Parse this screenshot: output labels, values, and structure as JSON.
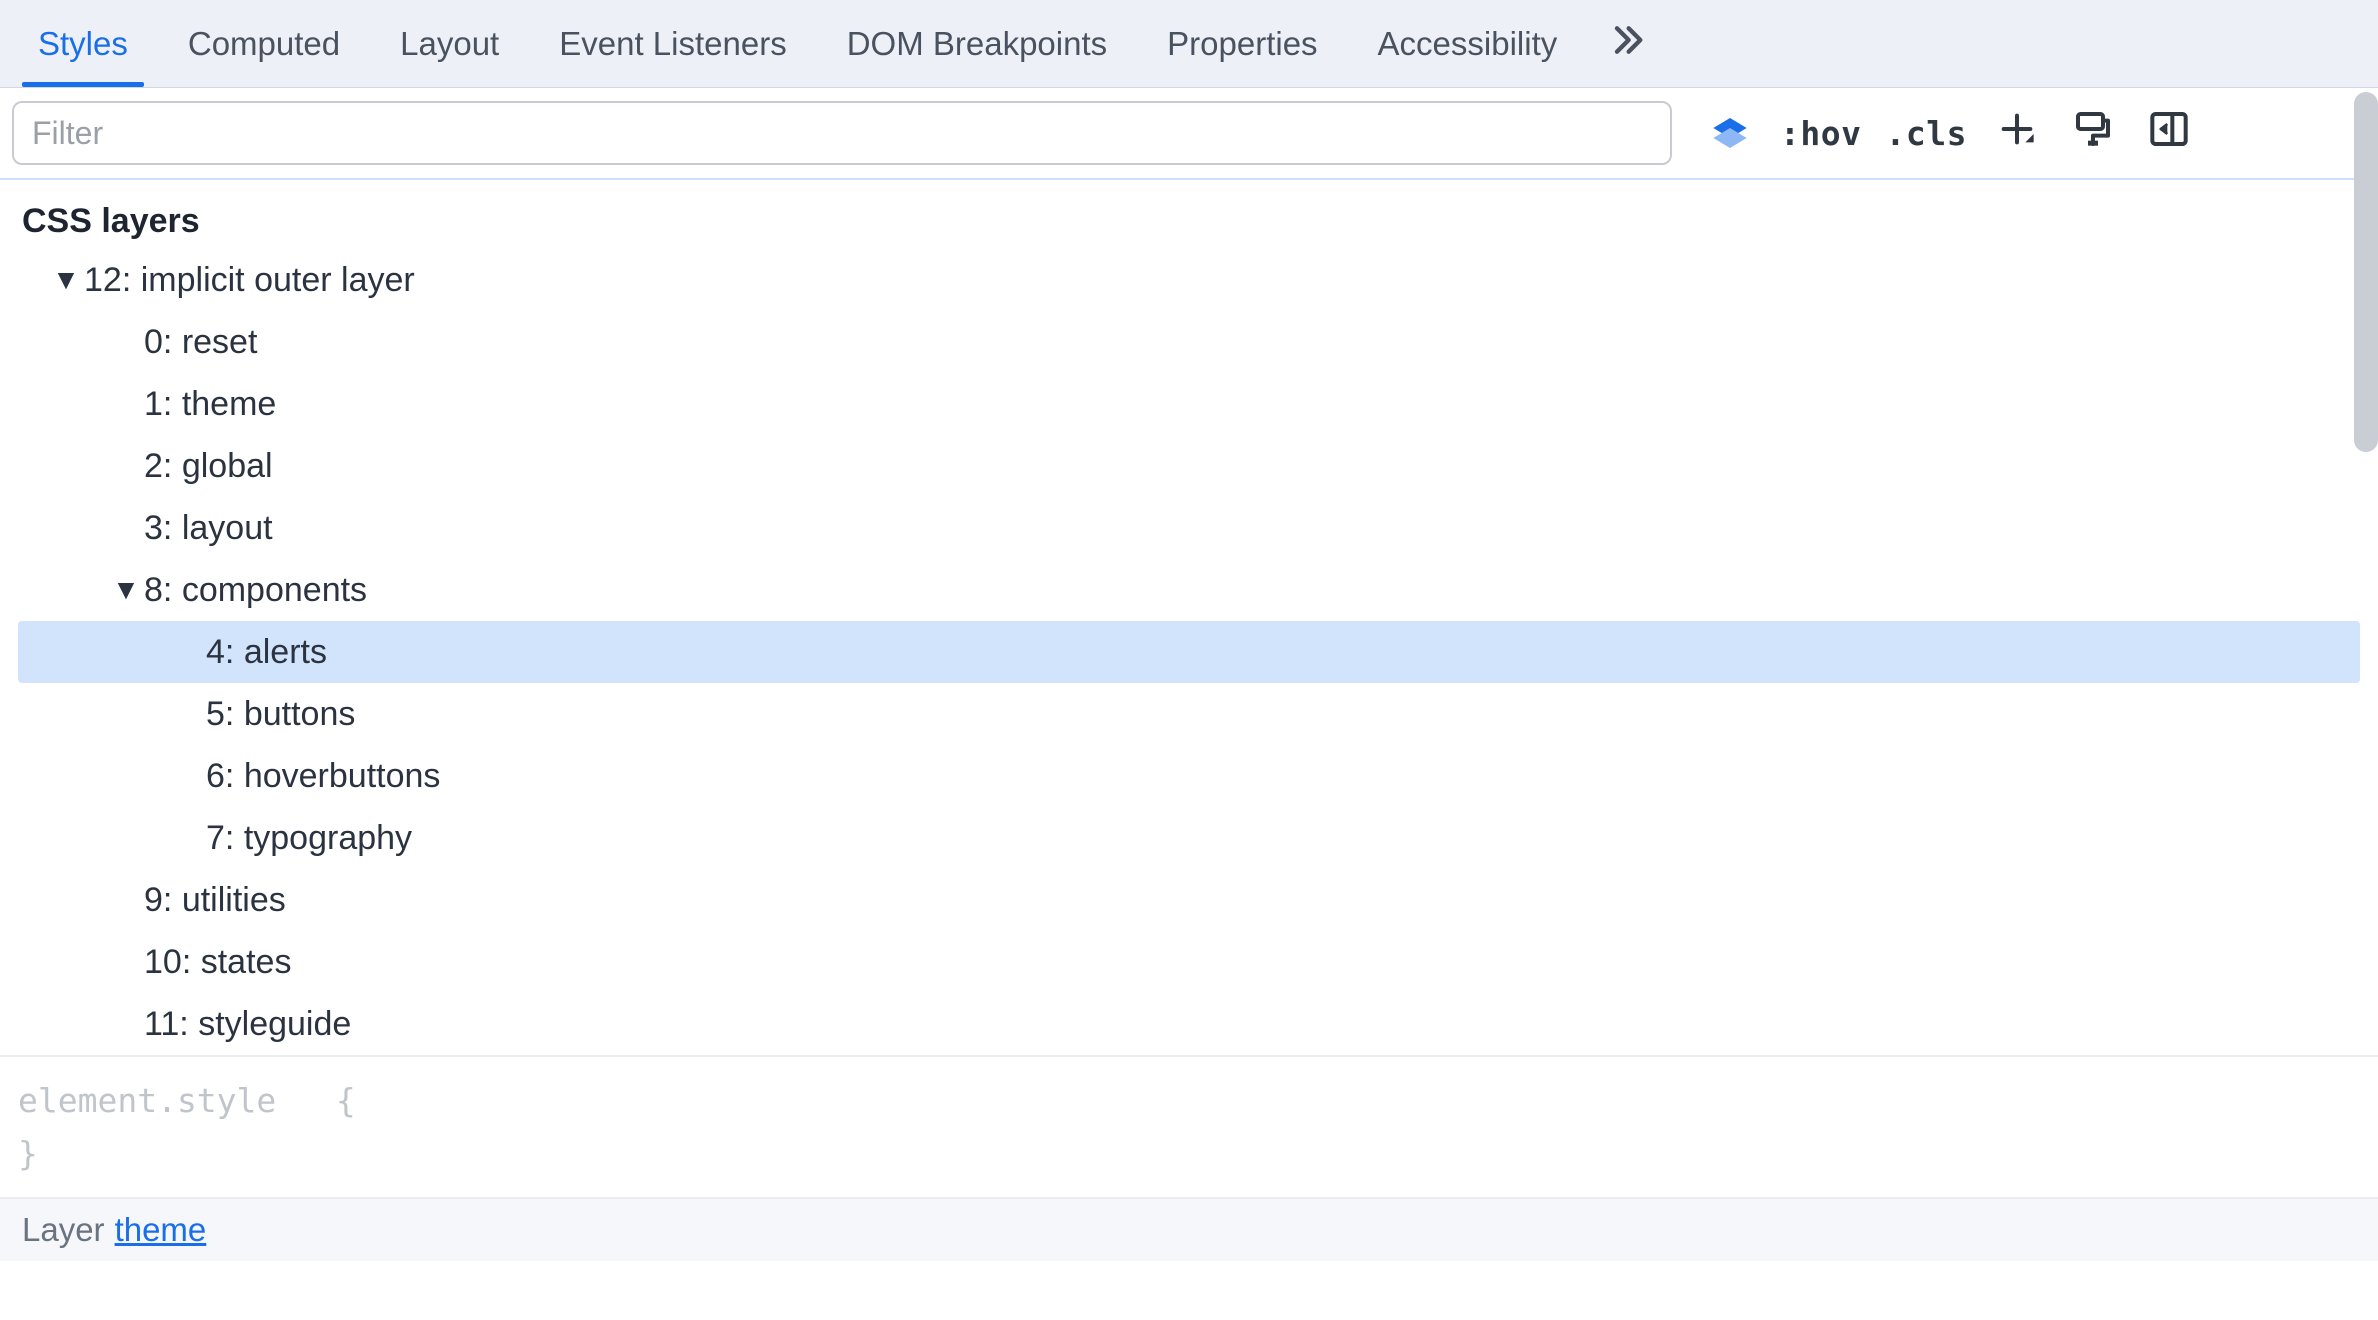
{
  "tabs": {
    "items": [
      {
        "label": "Styles",
        "active": true
      },
      {
        "label": "Computed",
        "active": false
      },
      {
        "label": "Layout",
        "active": false
      },
      {
        "label": "Event Listeners",
        "active": false
      },
      {
        "label": "DOM Breakpoints",
        "active": false
      },
      {
        "label": "Properties",
        "active": false
      },
      {
        "label": "Accessibility",
        "active": false
      }
    ]
  },
  "toolbar": {
    "filter_placeholder": "Filter",
    "hov_label": ":hov",
    "cls_label": ".cls"
  },
  "section": {
    "title": "CSS layers"
  },
  "layers": {
    "root": {
      "count": "12",
      "label": "implicit outer layer"
    },
    "children": [
      {
        "index": "0",
        "label": "reset"
      },
      {
        "index": "1",
        "label": "theme"
      },
      {
        "index": "2",
        "label": "global"
      },
      {
        "index": "3",
        "label": "layout"
      }
    ],
    "components": {
      "index": "8",
      "label": "components",
      "children": [
        {
          "index": "4",
          "label": "alerts",
          "selected": true
        },
        {
          "index": "5",
          "label": "buttons",
          "selected": false
        },
        {
          "index": "6",
          "label": "hoverbuttons",
          "selected": false
        },
        {
          "index": "7",
          "label": "typography",
          "selected": false
        }
      ]
    },
    "tail": [
      {
        "index": "9",
        "label": "utilities"
      },
      {
        "index": "10",
        "label": "states"
      },
      {
        "index": "11",
        "label": "styleguide"
      }
    ]
  },
  "rule": {
    "selector": "element.style",
    "open_brace": "{",
    "close_brace": "}"
  },
  "layer_strip": {
    "prefix": "Layer",
    "link": "theme"
  }
}
